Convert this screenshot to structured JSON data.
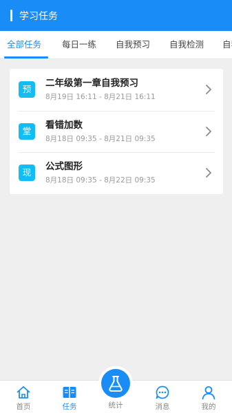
{
  "header": {
    "title": "学习任务"
  },
  "tabs": [
    {
      "label": "全部任务",
      "active": true
    },
    {
      "label": "每日一练",
      "active": false
    },
    {
      "label": "自我预习",
      "active": false
    },
    {
      "label": "自我检测",
      "active": false
    },
    {
      "label": "自我",
      "active": false
    }
  ],
  "tasks": [
    {
      "badge": "预",
      "title": "二年级第一章自我预习",
      "time": "8月19日 16:11 - 8月21日 16:11"
    },
    {
      "badge": "堂",
      "title": "看错加数",
      "time": "8月18日 09:35 - 8月21日 09:35"
    },
    {
      "badge": "现",
      "title": "公式图形",
      "time": "8月18日 09:35 - 8月22日 09:35"
    }
  ],
  "bottom_nav": {
    "home": {
      "label": "首页",
      "icon": "home-icon"
    },
    "tasks": {
      "label": "任务",
      "icon": "book-icon",
      "active": true
    },
    "stats": {
      "label": "统计",
      "icon": "flask-icon"
    },
    "messages": {
      "label": "消息",
      "icon": "chat-icon"
    },
    "me": {
      "label": "我的",
      "icon": "user-icon"
    }
  },
  "colors": {
    "primary": "#1a8cf5",
    "badge": "#13bdf4",
    "background": "#efefef"
  }
}
